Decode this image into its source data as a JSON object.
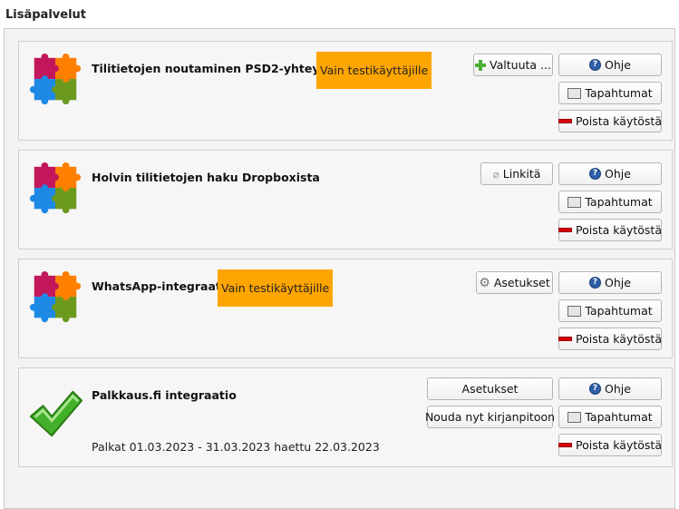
{
  "section": {
    "title": "Lisäpalvelut"
  },
  "colors": {
    "badge": "#ffa500",
    "group_bg": "#f3f3f3",
    "card_bg": "#f6f6f6"
  },
  "cards": [
    {
      "title": "Tilitietojen noutaminen PSD2-yhteydellä",
      "badge": "Vain testikäyttäjille",
      "icon": "puzzle-icon",
      "action": {
        "label": "Valtuuta ...",
        "icon": "plus-icon"
      },
      "help_label": "Ohje",
      "events_label": "Tapahtumat",
      "disable_label": "Poista käytöstä"
    },
    {
      "title": "Holvin tilitietojen haku Dropboxista",
      "icon": "puzzle-icon",
      "action": {
        "label": "Linkitä",
        "icon": "link-icon"
      },
      "help_label": "Ohje",
      "events_label": "Tapahtumat",
      "disable_label": "Poista käytöstä"
    },
    {
      "title": "WhatsApp-integraatio",
      "badge": "Vain testikäyttäjille",
      "icon": "puzzle-icon",
      "action": {
        "label": "Asetukset",
        "icon": "gear-icon"
      },
      "help_label": "Ohje",
      "events_label": "Tapahtumat",
      "disable_label": "Poista käytöstä"
    },
    {
      "title": "Palkkaus.fi integraatio",
      "subtitle": "Palkat 01.03.2023 - 31.03.2023 haettu 22.03.2023",
      "icon": "checkmark-icon",
      "settings_label": "Asetukset",
      "fetch_label": "Nouda nyt kirjanpitoon",
      "help_label": "Ohje",
      "events_label": "Tapahtumat",
      "disable_label": "Poista käytöstä"
    }
  ]
}
